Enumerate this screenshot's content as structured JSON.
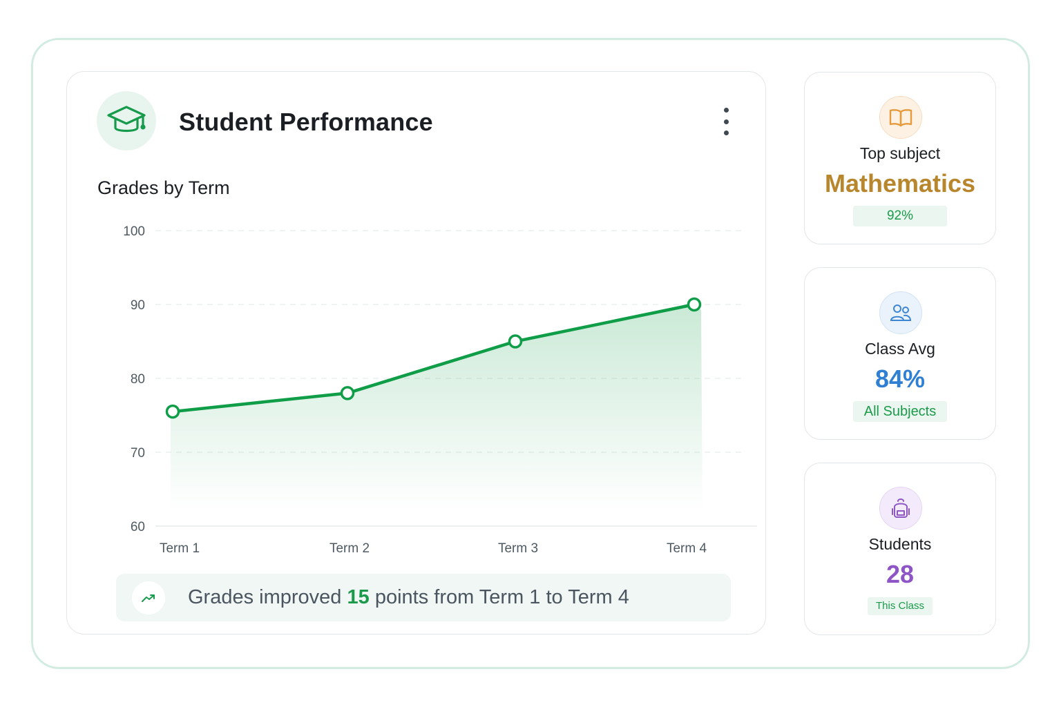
{
  "card": {
    "title": "Student Performance",
    "chart_title": "Grades by Term",
    "menu_icon": "kebab-menu-icon",
    "icon": "graduation-cap-icon"
  },
  "chart_data": {
    "type": "line",
    "title": "Grades by Term",
    "categories": [
      "Term 1",
      "Term 2",
      "Term 3",
      "Term 4"
    ],
    "series": [
      {
        "values": [
          75.5,
          78,
          85,
          90
        ]
      }
    ],
    "yticks": [
      100,
      90,
      80,
      70,
      60
    ],
    "ylim": [
      60,
      100
    ],
    "grid": true,
    "area_fill": true,
    "color": "#0f9d47"
  },
  "insight": {
    "icon": "trending-up-icon",
    "prefix": "Grades improved ",
    "highlight": "15",
    "suffix": " points from Term 1 to Term 4"
  },
  "stats": [
    {
      "icon": "book-icon",
      "label": "Top subject",
      "value": "Mathematics",
      "pill": "92%",
      "value_color": "#b8862c"
    },
    {
      "icon": "users-icon",
      "label": "Class Avg",
      "value": "84%",
      "pill": "All Subjects",
      "value_color": "#2f7fd3"
    },
    {
      "icon": "backpack-icon",
      "label": "Students",
      "value": "28",
      "pill": "This Class",
      "value_color": "#8e55c6"
    }
  ],
  "colors": {
    "accent_green": "#0f9d47",
    "frame_border": "#d3ece2"
  }
}
